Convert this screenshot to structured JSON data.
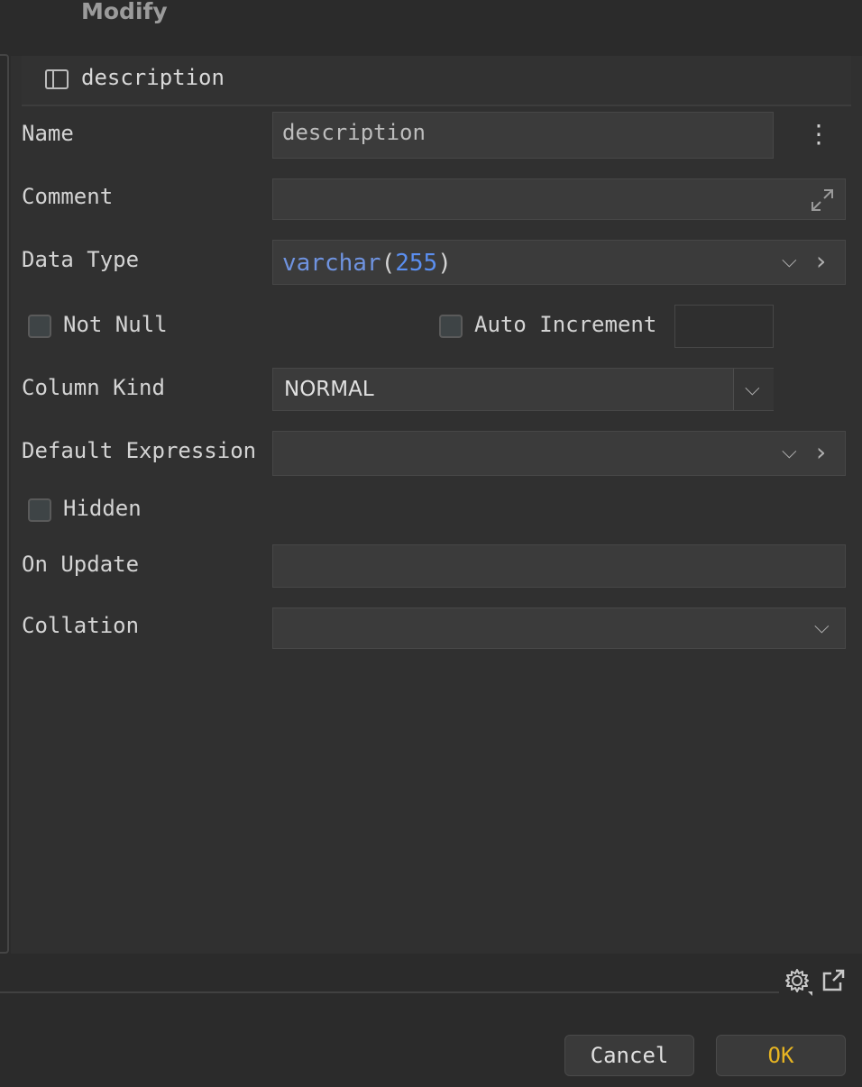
{
  "window": {
    "title": "Modify"
  },
  "header": {
    "column_name": "description"
  },
  "fields": {
    "name": {
      "label": "Name",
      "value": "description"
    },
    "comment": {
      "label": "Comment",
      "value": ""
    },
    "data_type": {
      "label": "Data Type",
      "type_keyword": "varchar",
      "open_paren": "(",
      "length": "255",
      "close_paren": ")"
    },
    "not_null": {
      "label": "Not Null",
      "checked": false
    },
    "auto_increment": {
      "label": "Auto Increment",
      "checked": false,
      "value": ""
    },
    "column_kind": {
      "label": "Column Kind",
      "value": "NORMAL"
    },
    "default_expression": {
      "label": "Default Expression",
      "value": ""
    },
    "hidden": {
      "label": "Hidden",
      "checked": false
    },
    "on_update": {
      "label": "On Update",
      "value": ""
    },
    "collation": {
      "label": "Collation",
      "value": ""
    }
  },
  "icons": {
    "more": "more-vertical-icon",
    "expand": "expand-icon",
    "chevron_down": "chevron-down-icon",
    "chevron_right": "chevron-right-icon",
    "settings": "gear-icon",
    "popout": "popout-icon"
  },
  "glyphs": {
    "chevron_down": "⌵",
    "chevron_right": "›",
    "more": "⋮"
  },
  "buttons": {
    "cancel": "Cancel",
    "ok": "OK"
  },
  "colors": {
    "ok_text": "#e6b422",
    "type_keyword": "#6f93e0",
    "type_number": "#5b8ff0"
  }
}
